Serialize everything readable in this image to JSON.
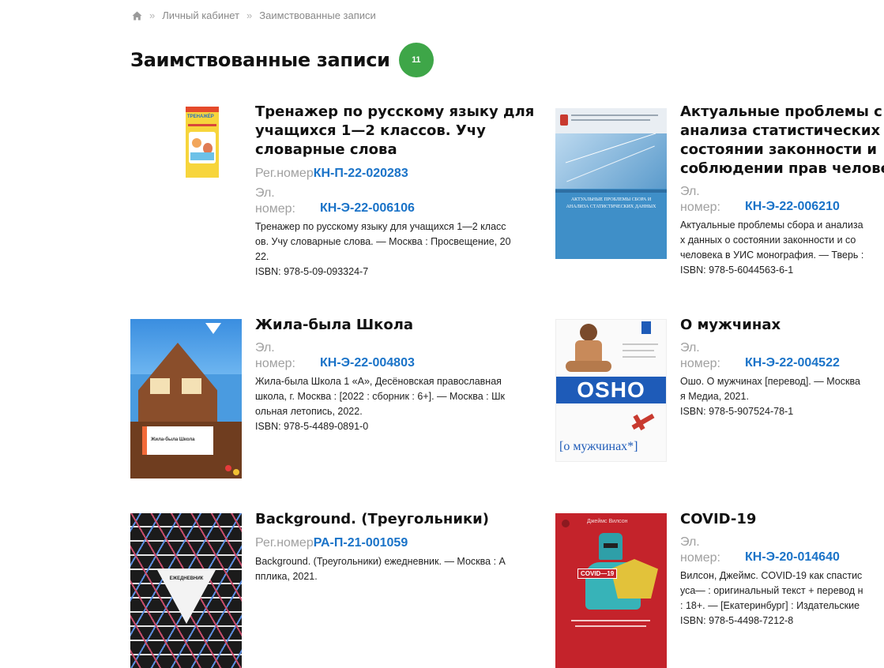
{
  "breadcrumb": {
    "home_icon": "home-icon",
    "sep1": "»",
    "item1": "Личный кабинет",
    "sep2": "»",
    "item2": "Заимствованные записи"
  },
  "page": {
    "title": "Заимствованные записи",
    "count": "11"
  },
  "labels": {
    "reg": "Рег.номер",
    "el": "Эл.\nномер:",
    "isbn_prefix": "ISBN:"
  },
  "books": [
    {
      "title": "Тренажер по русскому языку для\nучащихся 1—2 классов. Учу\nсловарные слова",
      "reg": "КН-П-22-020283",
      "el": "КН-Э-22-006106",
      "desc": "Тренажер по русскому языку для учащихся 1—2 класс\nов. Учу словарные слова. — Москва : Просвещение, 20\n22.",
      "isbn": "ISBN:  978-5-09-093324-7",
      "cover_text": "ТРЕНАЖЁР"
    },
    {
      "title": "Актуальные проблемы с\nанализа статистических\nсостоянии законности и\nсоблюдении прав челове",
      "el": "КН-Э-22-006210",
      "desc": "Актуальные проблемы сбора и анализа\nх данных о состоянии законности и со\nчеловека в УИС монография. — Тверь :",
      "isbn": "ISBN:  978-5-6044563-6-1",
      "cover_text": "АКТУАЛЬНЫЕ ПРОБЛЕМЫ СБОРА И АНАЛИЗА СТАТИСТИЧЕСКИХ ДАННЫХ"
    },
    {
      "title": "Жила-была Школа",
      "el": "КН-Э-22-004803",
      "desc": "Жила-была Школа 1 «А», Десёновская православная\nшкола, г. Москва : [2022 : сборник : 6+]. — Москва : Шк\nольная летопись, 2022.",
      "isbn": "ISBN:  978-5-4489-0891-0",
      "cover_text": "Жила-была Школа"
    },
    {
      "title": "О мужчинах",
      "el": "КН-Э-22-004522",
      "desc": "Ошо. О мужчинах [перевод]. — Москва\nя Медиа, 2021.",
      "isbn": "ISBN:  978-5-907524-78-1",
      "cover_brand": "OSHO",
      "cover_text": "[о мужчинах*]"
    },
    {
      "title": "Background. (Треугольники)",
      "reg": "РА-П-21-001059",
      "desc": "Background. (Треугольники) ежедневник. — Москва : А\nпплика, 2021.",
      "cover_text": "ЕЖЕДНЕВНИК"
    },
    {
      "title": "COVID-19",
      "el": "КН-Э-20-014640",
      "desc": "Вилсон, Джеймс. COVID-19 как спастис\nуса— : оригинальный текст + перевод н\n: 18+. — [Екатеринбург] : Издательские",
      "isbn": "ISBN:  978-5-4498-7212-8",
      "cover_author": "Джеймс Вилсон",
      "cover_text": "COVID—19"
    }
  ]
}
